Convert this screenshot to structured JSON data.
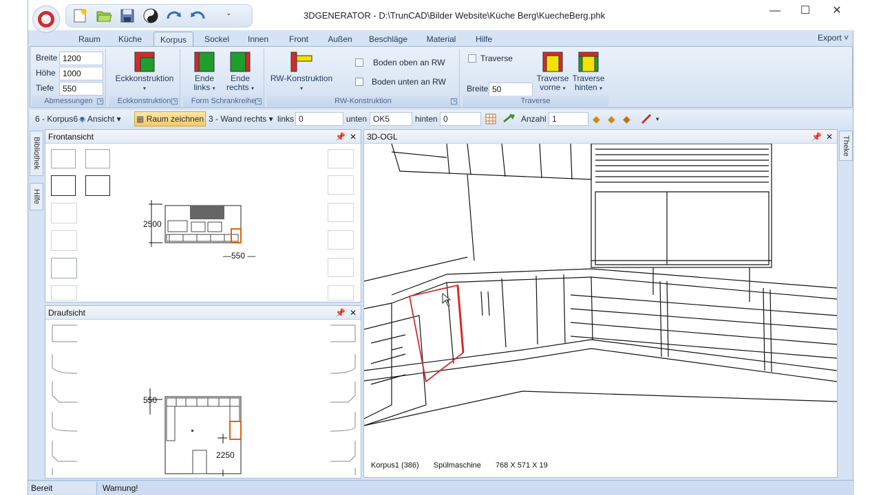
{
  "window": {
    "title": "3DGENERATOR  -  D:\\TrunCAD\\Bilder Website\\Küche Berg\\KuecheBerg.phk",
    "minimize": "—",
    "maximize": "☐",
    "close": "✕"
  },
  "quick_access": {
    "icons": [
      "new-icon",
      "open-icon",
      "save-icon",
      "yin-yang-icon",
      "redo-icon",
      "undo-icon"
    ],
    "dropdown": "⌄"
  },
  "tabs": [
    "Raum",
    "Küche",
    "Korpus",
    "Sockel",
    "Innen",
    "Front",
    "Außen",
    "Beschläge",
    "Material",
    "Hilfe"
  ],
  "active_tab": "Korpus",
  "export_label": "Export ˅",
  "ribbon": {
    "abmessungen": {
      "label": "Abmessungen",
      "breite_label": "Breite",
      "breite_value": "1200",
      "hoehe_label": "Höhe",
      "hoehe_value": "1000",
      "tiefe_label": "Tiefe",
      "tiefe_value": "550"
    },
    "eckkonstruktion": {
      "label": "Eckkonstruktion",
      "button": "Eckkonstruktion"
    },
    "form_schrankreihe": {
      "label": "Form Schrankreihe",
      "ende_links_1": "Ende",
      "ende_links_2": "links",
      "ende_rechts_1": "Ende",
      "ende_rechts_2": "rechts"
    },
    "rw_konstruktion": {
      "label": "RW-Konstruktion",
      "button": "RW-Konstruktion",
      "boden_oben": "Boden oben an RW",
      "boden_unten": "Boden unten an RW"
    },
    "traverse": {
      "label": "Traverse",
      "checkbox": "Traverse",
      "breite_label": "Breite",
      "breite_value": "50",
      "vorne_1": "Traverse",
      "vorne_2": "vorne",
      "hinten_1": "Traverse",
      "hinten_2": "hinten"
    }
  },
  "toolbar": {
    "korpus": "6 - Korpus6",
    "ansicht": "Ansicht",
    "raum_zeichnen": "Raum zeichnen",
    "wand": "3  - Wand rechts",
    "links_label": "links",
    "links_value": "0",
    "unten_label": "unten",
    "unten_value": "OK5",
    "hinten_label": "hinten",
    "hinten_value": "0",
    "anzahl_label": "Anzahl",
    "anzahl_value": "1"
  },
  "side_tabs": {
    "left_top": "Bibliothek",
    "left_bottom": "Hilfe",
    "right": "Theke"
  },
  "panels": {
    "front": {
      "title": "Frontansicht",
      "dim_height": "2500",
      "dim_depth": "550"
    },
    "top": {
      "title": "Draufsicht",
      "dim_depth": "550",
      "dim_width": "2250"
    },
    "view3d": {
      "title": "3D-OGL",
      "info_part": "Korpus1 (386)",
      "info_name": "Spülmaschine",
      "info_size": "768 X 571 X 19"
    }
  },
  "status": {
    "left": "Bereit",
    "warning": "Warnung!"
  },
  "colors": {
    "accent_red": "#d42a2a",
    "ribbon_green": "#1f9e2e",
    "ribbon_yellow": "#f4e200",
    "selection_orange": "#e06010"
  }
}
